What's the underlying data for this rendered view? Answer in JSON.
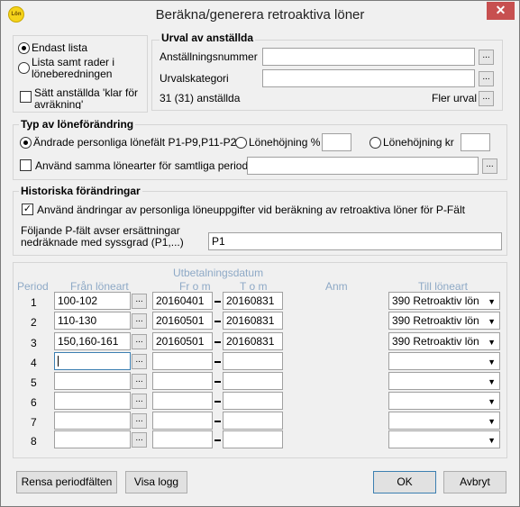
{
  "window": {
    "title": "Beräkna/generera retroaktiva löner",
    "app_icon_text": "Lön",
    "close_glyph": "✕"
  },
  "list_options": {
    "radio1": "Endast lista",
    "radio2": "Lista samt rader i löneberedningen",
    "checkbox": "Sätt anställda 'klar för avräkning'"
  },
  "selection": {
    "title": "Urval av anställda",
    "employee_number_label": "Anställningsnummer",
    "employee_number_value": "",
    "category_label": "Urvalskategori",
    "category_value": "",
    "count_text": "31 (31) anställda",
    "more_label": "Fler urval"
  },
  "change_type": {
    "title": "Typ av löneförändring",
    "radio_personal": "Ändrade personliga lönefält P1-P9,P11-P23",
    "radio_pct": "Lönehöjning %",
    "pct_value": "",
    "radio_kr": "Lönehöjning kr",
    "kr_value": "",
    "same_types_label": "Använd samma lönearter för samtliga perioder:",
    "same_types_value": ""
  },
  "history": {
    "title": "Historiska förändringar",
    "use_changes_label": "Använd ändringar av personliga löneuppgifter vid beräkning av retroaktiva löner för P-Fält",
    "fields_label": "Följande P-fält avser ersättningar nedräknade med syssgrad (P1,...)",
    "fields_value": "P1"
  },
  "period_table": {
    "headers": {
      "period": "Period",
      "from_type": "Från löneart",
      "payment_date": "Utbetalningsdatum",
      "from": "Fr o m",
      "to": "T o m",
      "note": "Anm",
      "to_type": "Till löneart"
    },
    "rows": [
      {
        "period": "1",
        "from_type": "100-102",
        "from": "20160401",
        "to": "20160831",
        "to_type": "390 Retroaktiv lön"
      },
      {
        "period": "2",
        "from_type": "110-130",
        "from": "20160501",
        "to": "20160831",
        "to_type": "390 Retroaktiv lön"
      },
      {
        "period": "3",
        "from_type": "150,160-161",
        "from": "20160501",
        "to": "20160831",
        "to_type": "390 Retroaktiv lön"
      },
      {
        "period": "4",
        "from_type": "",
        "from": "",
        "to": "",
        "to_type": ""
      },
      {
        "period": "5",
        "from_type": "",
        "from": "",
        "to": "",
        "to_type": ""
      },
      {
        "period": "6",
        "from_type": "",
        "from": "",
        "to": "",
        "to_type": ""
      },
      {
        "period": "7",
        "from_type": "",
        "from": "",
        "to": "",
        "to_type": ""
      },
      {
        "period": "8",
        "from_type": "",
        "from": "",
        "to": "",
        "to_type": ""
      }
    ]
  },
  "buttons": {
    "clear": "Rensa periodfälten",
    "log": "Visa logg",
    "ok": "OK",
    "cancel": "Avbryt",
    "dots": "..."
  }
}
